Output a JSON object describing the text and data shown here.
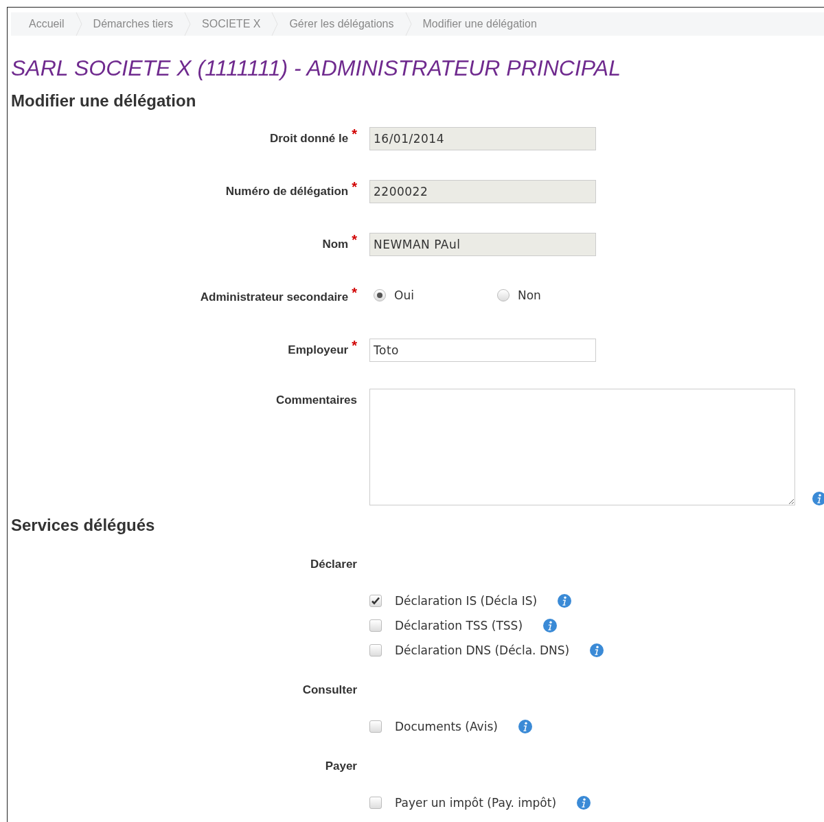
{
  "breadcrumb": [
    {
      "label": "Accueil"
    },
    {
      "label": "Démarches tiers"
    },
    {
      "label": "SOCIETE X"
    },
    {
      "label": "Gérer les délégations"
    },
    {
      "label": "Modifier une délégation"
    }
  ],
  "title": "SARL SOCIETE X (1111111) - ADMINISTRATEUR PRINCIPAL",
  "subtitle": "Modifier une délégation",
  "fields": [
    {
      "kind": "text",
      "label": "Droit donné le",
      "required_mark": "*",
      "readonly": true,
      "value": "16/01/2014"
    },
    {
      "kind": "text",
      "label": "Numéro de délégation",
      "required_mark": "*",
      "readonly": true,
      "value": "2200022"
    },
    {
      "kind": "text",
      "label": "Nom",
      "required_mark": "*",
      "readonly": true,
      "value": "NEWMAN PAul"
    },
    {
      "kind": "radio",
      "label": "Administrateur secondaire",
      "required_mark": "*",
      "options": [
        {
          "label": "Oui",
          "selected": true
        },
        {
          "label": "Non",
          "selected": false
        }
      ]
    },
    {
      "kind": "text",
      "label": "Employeur",
      "required_mark": "*",
      "readonly": false,
      "value": "Toto"
    },
    {
      "kind": "textarea",
      "label": "Commentaires"
    }
  ],
  "services": {
    "heading": "Services délégués",
    "groups": [
      {
        "label": "Déclarer",
        "items": [
          {
            "label": "Déclaration IS (Décla IS)",
            "checked": true
          },
          {
            "label": "Déclaration TSS (TSS)",
            "checked": false
          },
          {
            "label": "Déclaration DNS (Décla. DNS)",
            "checked": false
          }
        ]
      },
      {
        "label": "Consulter",
        "items": [
          {
            "label": "Documents (Avis)",
            "checked": false
          }
        ]
      },
      {
        "label": "Payer",
        "items": [
          {
            "label": "Payer un impôt (Pay. impôt)",
            "checked": false
          }
        ]
      }
    ]
  }
}
